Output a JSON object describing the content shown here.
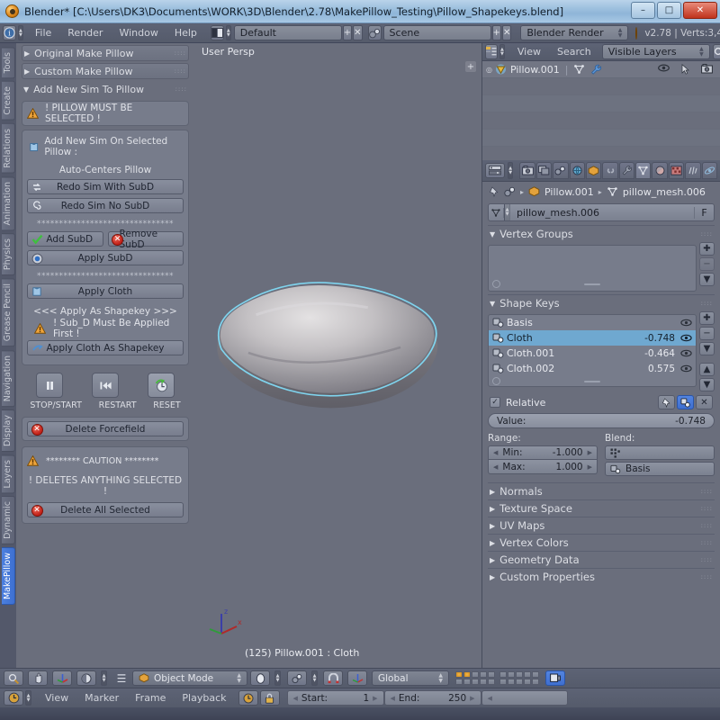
{
  "window": {
    "title": "Blender* [C:\\Users\\DK3\\Documents\\WORK\\3D\\Blender\\2.78\\MakePillow_Testing\\Pillow_Shapekeys.blend]",
    "minimize": "–",
    "maximize": "□",
    "close": "✕"
  },
  "header": {
    "menus": [
      "File",
      "Render",
      "Window",
      "Help"
    ],
    "screen_layout": "Default",
    "scene": "Scene",
    "engine": "Blender Render",
    "version_info": "v2.78 | Verts:3,4",
    "add_label": "+",
    "remove_label": "✕"
  },
  "toolbar_tabs": [
    {
      "label": "Tools",
      "active": false
    },
    {
      "label": "Create",
      "active": false
    },
    {
      "label": "Relations",
      "active": false
    },
    {
      "label": "Animation",
      "active": false
    },
    {
      "label": "Physics",
      "active": false
    },
    {
      "label": "Grease Pencil",
      "active": false
    },
    {
      "label": "Navigation",
      "active": false
    },
    {
      "label": "Display",
      "active": false
    },
    {
      "label": "Layers",
      "active": false
    },
    {
      "label": "Dynamic",
      "active": false
    },
    {
      "label": "MakePillow",
      "active": true
    }
  ],
  "toolshelf": {
    "panel_original": "Original Make Pillow",
    "panel_custom": "Custom Make Pillow",
    "panel_addnew": "Add New Sim To Pillow",
    "warn_selected": "! PILLOW MUST BE SELECTED !",
    "add_sim_title": "Add New Sim On Selected Pillow :",
    "auto_centers": "Auto-Centers Pillow",
    "redo_with_subd": "Redo Sim With SubD",
    "redo_no_subd": "Redo Sim No SubD",
    "stars": "*******************************",
    "add_subd": "Add SubD",
    "remove_subd": "Remove SubD",
    "apply_subd": "Apply SubD",
    "apply_cloth": "Apply Cloth",
    "apply_as_shapekey_banner": "<<< Apply As Shapekey >>>",
    "warn_subd_first": "! Sub_D Must Be Applied First !",
    "apply_cloth_as_shapekey": "Apply Cloth As Shapekey",
    "stopstart": "STOP/START",
    "restart": "RESTART",
    "reset": "RESET",
    "delete_forcefield": "Delete Forcefield",
    "caution": "********    CAUTION    ********",
    "deletes_anything": "! DELETES ANYTHING SELECTED !",
    "delete_all_selected": "Delete All Selected"
  },
  "viewport": {
    "view_name": "User Persp",
    "status": "(125) Pillow.001 : Cloth",
    "axis_z": "z",
    "axis_x": "x",
    "plus": "+"
  },
  "outliner": {
    "menus": [
      "View",
      "Search"
    ],
    "filter": "Visible Layers",
    "object": "Pillow.001"
  },
  "properties": {
    "breadcrumb_object": "Pillow.001",
    "breadcrumb_mesh": "pillow_mesh.006",
    "breadcrumb_sep": "▸",
    "mesh_name": "pillow_mesh.006",
    "fake_user": "F",
    "vertex_groups": {
      "title": "Vertex Groups",
      "items": []
    },
    "shape_keys": {
      "title": "Shape Keys",
      "items": [
        {
          "name": "Basis",
          "value": "",
          "selected": false
        },
        {
          "name": "Cloth",
          "value": "-0.748",
          "selected": true
        },
        {
          "name": "Cloth.001",
          "value": "-0.464",
          "selected": false
        },
        {
          "name": "Cloth.002",
          "value": "0.575",
          "selected": false
        }
      ],
      "relative_label": "Relative",
      "value_label": "Value:",
      "value": "-0.748",
      "range_label": "Range:",
      "min_label": "Min:",
      "min_value": "-1.000",
      "max_label": "Max:",
      "max_value": "1.000",
      "blend_label": "Blend:",
      "blend_vertex_group": "",
      "blend_basis": "Basis"
    },
    "collapsed_sections": [
      "Normals",
      "Texture Space",
      "UV Maps",
      "Vertex Colors",
      "Geometry Data",
      "Custom Properties"
    ]
  },
  "viewport_footer": {
    "mode": "Object Mode",
    "transform_orientation": "Global"
  },
  "timeline": {
    "menus": [
      "View",
      "Marker",
      "Frame",
      "Playback"
    ],
    "start_label": "Start:",
    "start_value": "1",
    "end_label": "End:",
    "end_value": "250"
  },
  "colors": {
    "background": "#6a6e7c",
    "header": "#585e6f",
    "selected_row": "#6fa8d0",
    "active_tab": "#4275d6",
    "warning": "#e8a33d",
    "danger": "#c12018",
    "title_bar": "#9dc0de"
  }
}
